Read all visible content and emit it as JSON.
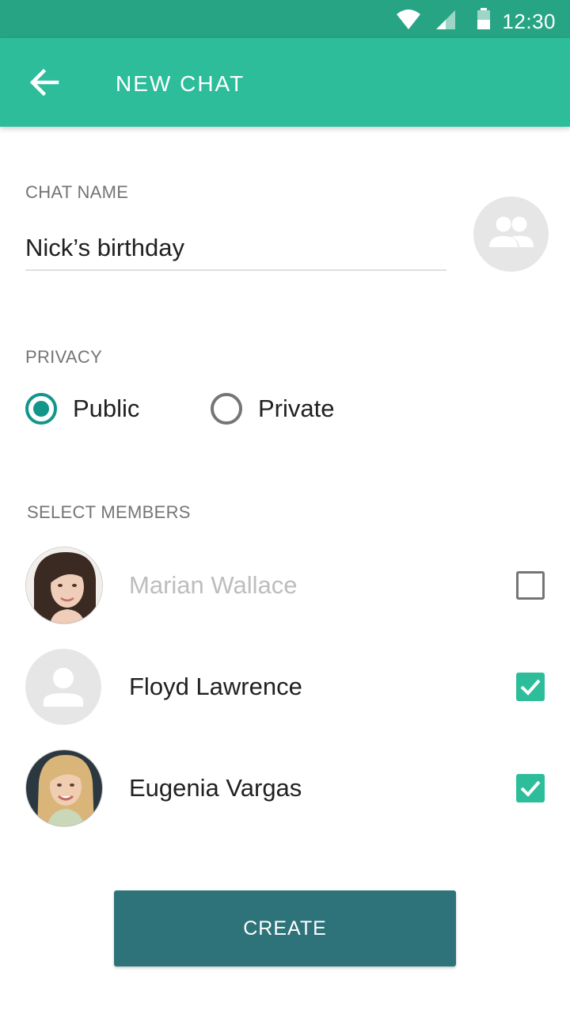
{
  "status_bar": {
    "time": "12:30",
    "icons": [
      "wifi-icon",
      "cell-signal-icon",
      "battery-icon"
    ]
  },
  "app_bar": {
    "title": "NEW CHAT",
    "back_icon": "arrow-back-icon"
  },
  "chat_name": {
    "label": "CHAT NAME",
    "value": "Nick’s birthday",
    "group_avatar_icon": "group-icon"
  },
  "privacy": {
    "label": "PRIVACY",
    "options": [
      {
        "label": "Public",
        "selected": true
      },
      {
        "label": "Private",
        "selected": false
      }
    ]
  },
  "members": {
    "label": "SELECT MEMBERS",
    "items": [
      {
        "name": "Marian Wallace",
        "checked": false,
        "avatar": "photo"
      },
      {
        "name": "Floyd Lawrence",
        "checked": true,
        "avatar": "placeholder-person-icon"
      },
      {
        "name": "Eugenia Vargas",
        "checked": true,
        "avatar": "photo"
      }
    ]
  },
  "create_button": {
    "label": "CREATE"
  },
  "colors": {
    "status_bar": "#26a484",
    "app_bar": "#2dbd9a",
    "radio_accent": "#12968a",
    "checkbox_accent": "#2dbd9a",
    "button": "#2f737a"
  }
}
